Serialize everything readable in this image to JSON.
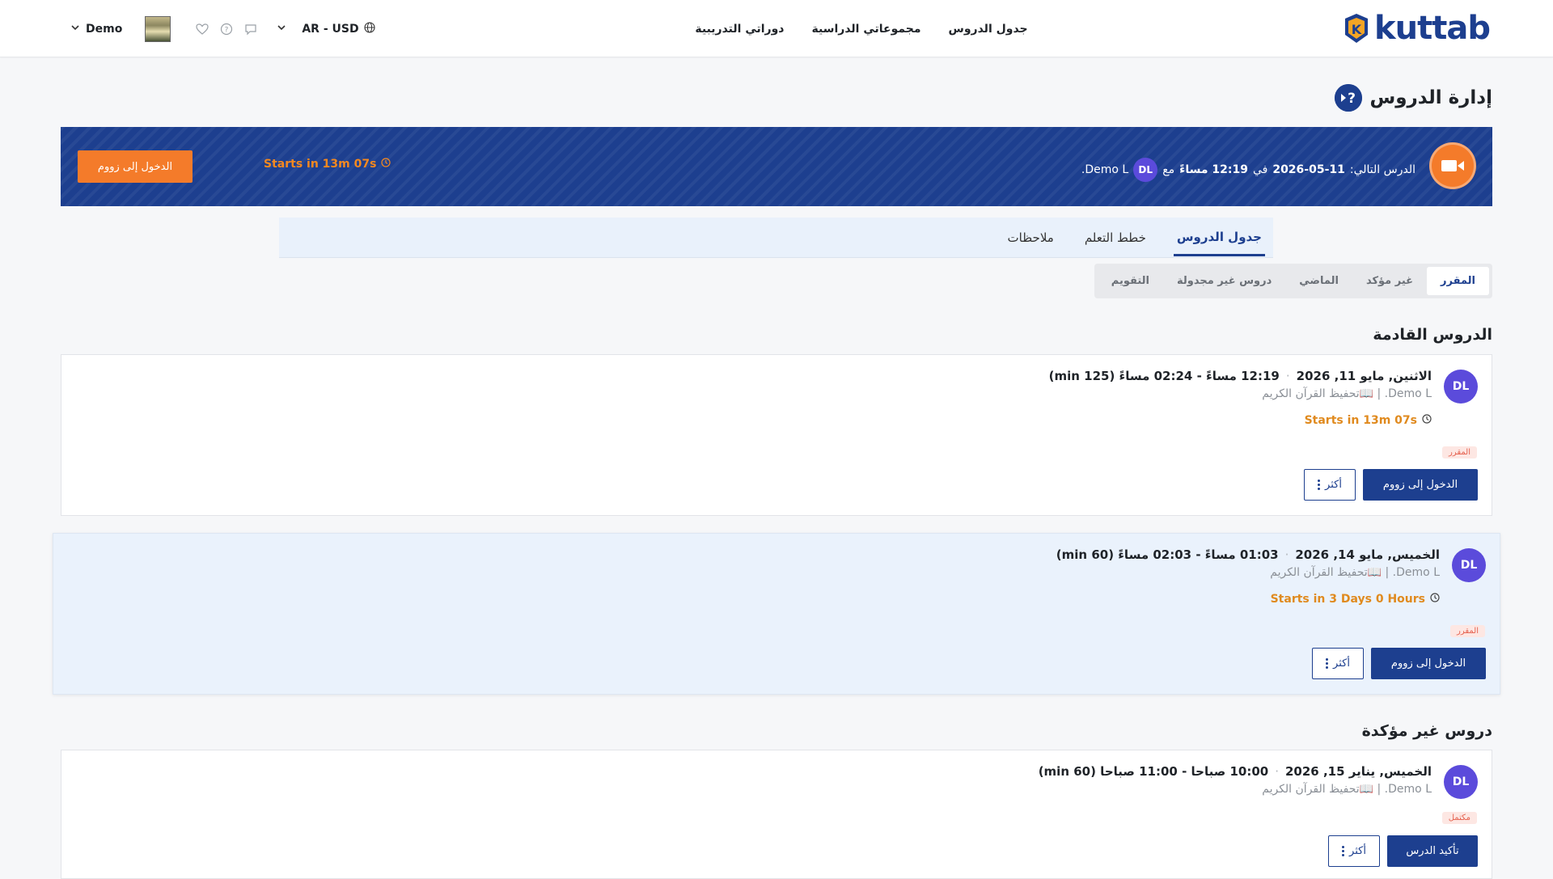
{
  "header": {
    "logo_text": "kuttab",
    "nav": [
      "جدول الدروس",
      "مجموعاتي الدراسية",
      "دوراتي التدريبية"
    ],
    "user_name": "Demo",
    "currency": "AR - USD"
  },
  "page": {
    "title": "إدارة الدروس"
  },
  "banner": {
    "prefix": "الدرس التالي:",
    "date": "2026-05-11",
    "at": "في",
    "time": "12:19 مساءً",
    "with": "مع",
    "initials": "DL",
    "teacher": "Demo L.",
    "timer": "Starts in 13m 07s",
    "button": "الدخول إلى زووم"
  },
  "tabs": [
    "جدول الدروس",
    "خطط التعلم",
    "ملاحظات"
  ],
  "subtabs": [
    "المقرر",
    "غير مؤكد",
    "الماضي",
    "دروس غير مجدولة",
    "التقويم"
  ],
  "sections": {
    "upcoming": "الدروس القادمة",
    "unconfirmed": "دروس غير مؤكدة"
  },
  "lessons": [
    {
      "initials": "DL",
      "date": "الاثنين, مايو 11, 2026",
      "time": "12:19 مساءً - 02:24 مساءً (125 min)",
      "subtitle": "Demo L. | 📖تحفيظ القرآن الكريم",
      "timer": "Starts in 13m 07s",
      "status": "المقرر",
      "primary": "الدخول إلى زووم",
      "more": "أكثر"
    },
    {
      "initials": "DL",
      "date": "الخميس, مايو 14, 2026",
      "time": "01:03 مساءً - 02:03 مساءً (60 min)",
      "subtitle": "Demo L. | 📖تحفيظ القرآن الكريم",
      "timer": "Starts in 3 Days 0 Hours",
      "status": "المقرر",
      "primary": "الدخول إلى زووم",
      "more": "أكثر"
    },
    {
      "initials": "DL",
      "date": "الخميس, يناير 15, 2026",
      "time": "10:00 صباحا - 11:00 صباحا (60 min)",
      "subtitle": "Demo L. | 📖تحفيظ القرآن الكريم",
      "status": "مكتمل",
      "primary": "تأكيد الدرس",
      "more": "أكثر"
    }
  ],
  "colors": {
    "primary": "#1d3f8f",
    "accent": "#f47b2a",
    "avatar": "#5b4bdb",
    "timer": "#e08a1e"
  }
}
